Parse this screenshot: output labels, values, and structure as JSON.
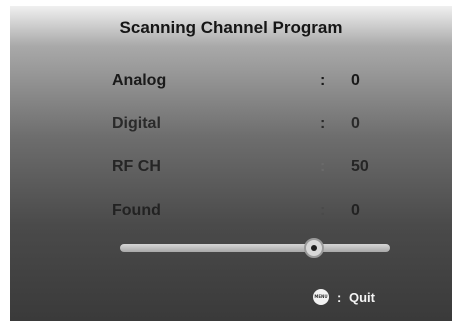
{
  "title": "Scanning Channel Program",
  "rows": [
    {
      "label": "Analog",
      "separator": ":",
      "value": "0"
    },
    {
      "label": "Digital",
      "separator": ":",
      "value": "0"
    },
    {
      "label": "RF CH",
      "separator": ":",
      "value": "50"
    },
    {
      "label": "Found",
      "separator": ":",
      "value": "0"
    }
  ],
  "progress": {
    "fraction": 0.72
  },
  "footer": {
    "icon": "menu-button-icon",
    "icon_text": "MENU",
    "separator": ":",
    "quit_label": "Quit"
  },
  "colors": {
    "text_dark": "#161616",
    "footer_text": "#f4f4f4"
  }
}
